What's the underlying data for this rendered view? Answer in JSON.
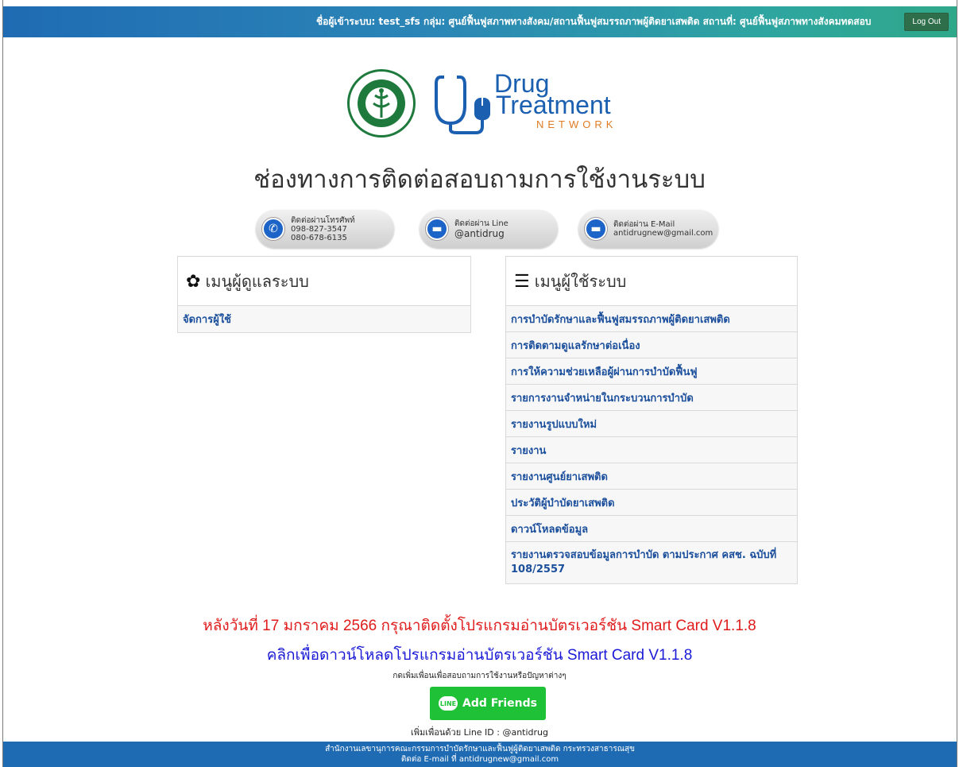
{
  "topbar": {
    "user_info": "ชื่อผู้เข้าระบบ: test_sfs กลุ่ม: ศูนย์ฟื้นฟูสภาพทางสังคม/สถานฟื้นฟูสมรรถภาพผู้ติดยาเสพติด สถานที่: ศูนย์ฟื้นฟูสภาพทางสังคมทดสอบ",
    "logout_label": "Log Out"
  },
  "logo": {
    "drug": "Drug",
    "treatment": "Treatment",
    "network": "NETWORK",
    "brand_blue": "#1b5fb0",
    "brand_orange": "#e07b22"
  },
  "page_title": "ช่องทางการติดต่อสอบถามการใช้งานระบบ",
  "contacts": [
    {
      "label": "ติดต่อผ่านโทรศัพท์",
      "line1": "098-827-3547",
      "line2": "080-678-6135",
      "icon": "phone-icon"
    },
    {
      "label": "ติดต่อผ่าน Line",
      "line1": "@antidrug",
      "icon": "chat-icon"
    },
    {
      "label": "ติดต่อผ่าน E-Mail",
      "line1": "antidrugnew@gmail.com",
      "icon": "mail-icon"
    }
  ],
  "admin_menu": {
    "title": "เมนูผู้ดูแลระบบ",
    "icon": "gear-icon",
    "items": [
      "จัดการผู้ใช้"
    ]
  },
  "user_menu": {
    "title": "เมนูผู้ใช้ระบบ",
    "icon": "user-list-icon",
    "items": [
      "การบำบัดรักษาและฟื้นฟูสมรรถภาพผู้ติดยาเสพติด",
      "การติดตามดูแลรักษาต่อเนื่อง",
      "การให้ความช่วยเหลือผู้ผ่านการบำบัดฟื้นฟู",
      "รายการงานจำหน่ายในกระบวนการบำบัด",
      "รายงานรูปแบบใหม่",
      "รายงาน",
      "รายงานศูนย์ยาเสพติด",
      "ประวัติผู้บำบัดยาเสพติด",
      "ดาวน์โหลดข้อมูล",
      "รายงานตรวจสอบข้อมูลการบำบัด ตามประกาศ คสช. ฉบับที่ 108/2557"
    ]
  },
  "notice_red": "หลังวันที่ 17 มกราคม 2566 กรุณาติดตั้งโปรแกรมอ่านบัตรเวอร์ชัน Smart Card V1.1.8",
  "notice_blue": "คลิกเพื่อดาวน์โหลดโปรแกรมอ่านบัตรเวอร์ชัน Smart Card V1.1.8",
  "add_friend_note": "กดเพิ่มเพื่อนเพื่อสอบถามการใช้งานหรือปัญหาต่างๆ",
  "add_friend": {
    "badge": "LINE",
    "label": "Add Friends"
  },
  "line_id": "เพิ่มเพื่อนด้วย Line ID : @antidrug",
  "footer": {
    "line1": "สำนักงานเลขานุการคณะกรรมการบำบัดรักษาและฟื้นฟูผู้ติดยาเสพติด กระทรวงสาธารณสุข",
    "line2": "ติดต่อ E-mail ที่ antidrugnew@gmail.com"
  },
  "colors": {
    "accent_blue": "#1f6bb3",
    "menu_link": "#1b4f9c",
    "notice_red": "#e01b1b",
    "notice_blue": "#1a1ad6",
    "line_green": "#1fc136"
  }
}
